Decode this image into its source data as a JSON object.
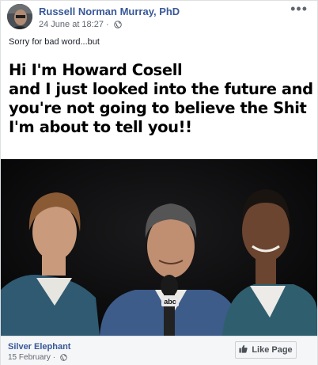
{
  "post": {
    "author": "Russell Norman Murray, PhD",
    "timestamp": "24 June at 18:27 ·",
    "caption": "Sorry for bad word...but",
    "more_label": "•••"
  },
  "meme": {
    "lines": [
      "Hi I'm Howard Cosell",
      "and I just looked into the future and",
      "you're not going to believe the Shit",
      "I'm about to tell you!!"
    ],
    "microphone_logo": "abc"
  },
  "shared_from": {
    "page_name": "Silver Elephant",
    "date": "15 February ·",
    "like_page_label": "Like Page"
  },
  "colors": {
    "link": "#385898",
    "meta": "#616770",
    "background": "#e9ebee"
  },
  "icons": {
    "privacy": "globe-icon",
    "more": "more-options-icon",
    "like": "thumbs-up-icon"
  }
}
